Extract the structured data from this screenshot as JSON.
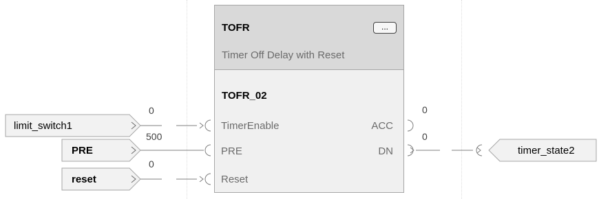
{
  "block": {
    "type_name": "TOFR",
    "description": "Timer Off Delay with Reset",
    "tag_name": "TOFR_02",
    "menu_button_label": "...",
    "inputs": [
      "TimerEnable",
      "PRE",
      "Reset"
    ],
    "outputs": [
      "ACC",
      "DN"
    ]
  },
  "input_tags": [
    "limit_switch1",
    "PRE",
    "reset"
  ],
  "output_tags": [
    "timer_state2"
  ],
  "wire_values": {
    "timer_enable": "0",
    "pre": "500",
    "reset": "0",
    "acc": "0",
    "dn": "0"
  },
  "colors": {
    "block_header": "#d9d9d9",
    "block_body": "#f0f0f0",
    "tag_fill": "#f2f2f2",
    "border": "#a6a6a6"
  }
}
